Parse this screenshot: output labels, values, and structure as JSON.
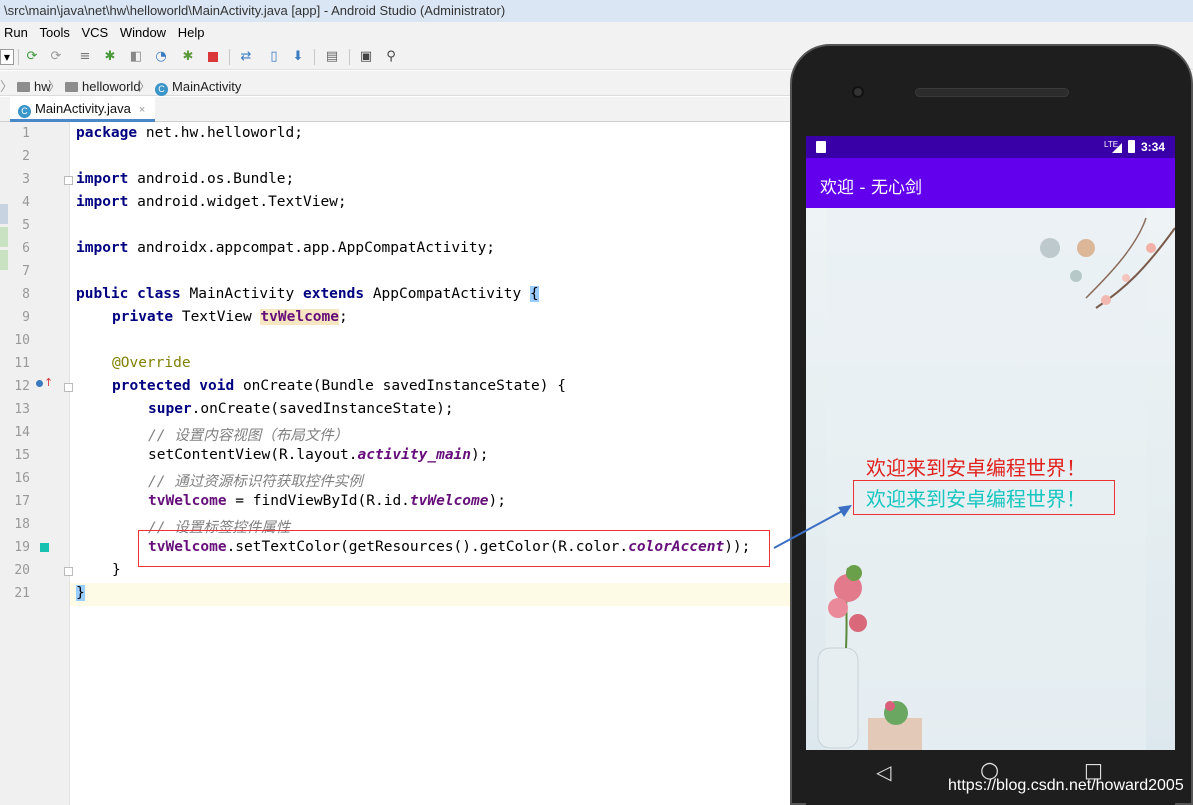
{
  "window": {
    "title": "\\src\\main\\java\\net\\hw\\helloworld\\MainActivity.java [app] - Android Studio (Administrator)"
  },
  "menu": [
    "Run",
    "Tools",
    "VCS",
    "Window",
    "Help"
  ],
  "toolbar": {
    "icons": [
      "sync-icon",
      "rerun-icon",
      "list-icon",
      "debug-icon",
      "attach-icon",
      "profile-icon",
      "apply-icon",
      "run-icon",
      "stop-icon",
      "gradle-sync-icon",
      "avd-icon",
      "sdk-icon",
      "structure-icon",
      "layout-icon",
      "search-icon"
    ]
  },
  "breadcrumb": {
    "items": [
      "hw",
      "helloworld",
      "MainActivity"
    ]
  },
  "tab": {
    "label": "MainActivity.java",
    "close": "×"
  },
  "editor": {
    "line_numbers": [
      "1",
      "2",
      "3",
      "4",
      "5",
      "6",
      "7",
      "8",
      "9",
      "10",
      "11",
      "12",
      "13",
      "14",
      "15",
      "16",
      "17",
      "18",
      "19",
      "20",
      "21"
    ],
    "code": {
      "l1_kw": "package",
      "l1_rest": " net.hw.helloworld;",
      "l3_kw": "import",
      "l3_rest": " android.os.Bundle;",
      "l4_kw": "import",
      "l4_rest": " android.widget.TextView;",
      "l6_kw": "import",
      "l6_rest": " androidx.appcompat.app.AppCompatActivity;",
      "l8_kw1": "public class",
      "l8_mid": " MainActivity ",
      "l8_kw2": "extends",
      "l8_rest": " AppCompatActivity ",
      "l8_brace": "{",
      "l9_kw": "private",
      "l9_mid": " TextView ",
      "l9_field": "tvWelcome",
      "l9_end": ";",
      "l11_anno": "@Override",
      "l12_kw": "protected void",
      "l12_rest": " onCreate(Bundle savedInstanceState) {",
      "l13_kw": "super",
      "l13_rest": ".onCreate(savedInstanceState);",
      "l14_cmt": "// 设置内容视图（布局文件）",
      "l15_pre": "setContentView(R.layout.",
      "l15_field": "activity_main",
      "l15_end": ");",
      "l16_cmt": "// 通过资源标识符获取控件实例",
      "l17_field": "tvWelcome",
      "l17_mid": " = findViewById(R.id.",
      "l17_fieldit": "tvWelcome",
      "l17_end": ");",
      "l18_cmt": "// 设置标签控件属性",
      "l19_field": "tvWelcome",
      "l19_mid": ".setTextColor(getResources().getColor(R.color.",
      "l19_fieldit": "colorAccent",
      "l19_end": "));",
      "l20": "}",
      "l21": "}"
    }
  },
  "phone": {
    "status": {
      "time": "3:34",
      "network": "LTE"
    },
    "app_title": "欢迎 - 无心剑",
    "welcome_red": "欢迎来到安卓编程世界！",
    "welcome_accent": "欢迎来到安卓编程世界！",
    "nav": {
      "back": "◁",
      "home": "○",
      "recent": "□"
    }
  },
  "colors": {
    "red_text": "#e0221e",
    "accent_text": "#18c6c0",
    "app_bar": "#6200ee",
    "status_bar": "#3a00a8",
    "annotation_box": "#e33333"
  },
  "watermark": "https://blog.csdn.net/howard2005"
}
